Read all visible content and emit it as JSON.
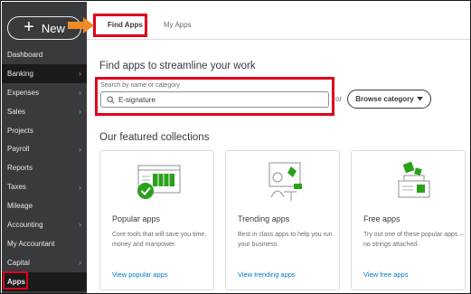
{
  "sidebar": {
    "new_label": "New",
    "items": [
      {
        "label": "Dashboard",
        "chevron": false
      },
      {
        "label": "Banking",
        "chevron": true
      },
      {
        "label": "Expenses",
        "chevron": true
      },
      {
        "label": "Sales",
        "chevron": true
      },
      {
        "label": "Projects",
        "chevron": false
      },
      {
        "label": "Payroll",
        "chevron": true
      },
      {
        "label": "Reports",
        "chevron": false
      },
      {
        "label": "Taxes",
        "chevron": true
      },
      {
        "label": "Mileage",
        "chevron": false
      },
      {
        "label": "Accounting",
        "chevron": true
      },
      {
        "label": "My Accountant",
        "chevron": false
      },
      {
        "label": "Capital",
        "chevron": true
      },
      {
        "label": "Apps",
        "chevron": false
      }
    ],
    "chevron_glyph": "›"
  },
  "tabs": {
    "find_apps": "Find Apps",
    "my_apps": "My Apps"
  },
  "main": {
    "heading": "Find apps to streamline your work",
    "search": {
      "label": "Search by name or category",
      "value": "E-signature"
    },
    "or_text": "or",
    "browse_label": "Browse category",
    "featured_heading": "Our featured collections",
    "cards": [
      {
        "title": "Popular apps",
        "desc": "Core tools that will save you time, money and manpower.",
        "link": "View popular apps"
      },
      {
        "title": "Trending apps",
        "desc": "Best in class apps to help you run your business.",
        "link": "View trending apps"
      },
      {
        "title": "Free apps",
        "desc": "Try out one of these popular apps – no strings attached.",
        "link": "View free apps"
      }
    ]
  },
  "colors": {
    "sidebar_bg": "#393a3d",
    "accent_green": "#2ca01c",
    "highlight_red": "#e0001b",
    "link_blue": "#0077c5",
    "arrow_orange": "#f08a24"
  },
  "icons": {
    "plus": "plus-icon",
    "search": "search-icon",
    "caret": "caret-down-icon"
  }
}
